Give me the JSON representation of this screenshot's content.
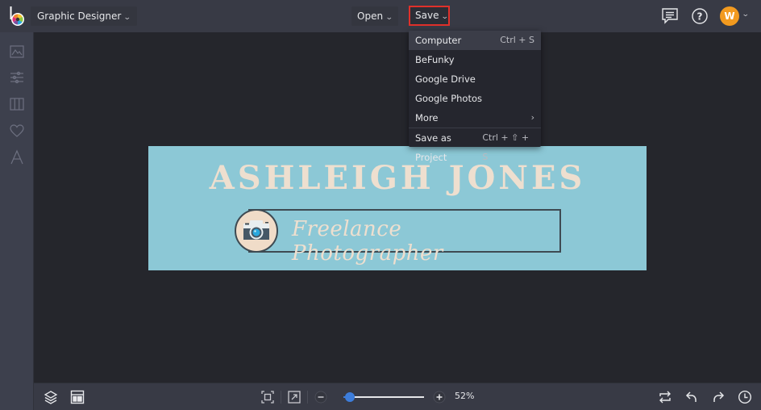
{
  "app": {
    "name": "BeFunky",
    "mode_label": "Graphic Designer"
  },
  "topbar": {
    "open_label": "Open",
    "save_label": "Save",
    "icons": [
      "chat-icon",
      "help-icon"
    ],
    "avatar_initial": "W",
    "avatar_color": "#f29a1f"
  },
  "save_menu": {
    "items": [
      {
        "label": "Computer",
        "shortcut": "Ctrl + S",
        "highlighted": true
      },
      {
        "label": "BeFunky",
        "shortcut": ""
      },
      {
        "label": "Google Drive",
        "shortcut": ""
      },
      {
        "label": "Google Photos",
        "shortcut": ""
      },
      {
        "label": "More",
        "shortcut": "›",
        "submenu": true
      },
      {
        "label": "Save as Project",
        "shortcut": "Ctrl + ⇧ + S"
      }
    ]
  },
  "sidebar": {
    "items": [
      "image-manager-icon",
      "customize-icon",
      "layouts-icon",
      "graphics-icon",
      "text-icon"
    ]
  },
  "design": {
    "background_color": "#8cc8d6",
    "title": "ASHLEIGH JONES",
    "tagline": "Freelance Photographer",
    "text_color": "#eedfcf"
  },
  "bottombar": {
    "zoom_percent": 52,
    "zoom_label": "52%",
    "zoom_slider_fraction": 0.08,
    "accent_color": "#3d7ddb"
  }
}
